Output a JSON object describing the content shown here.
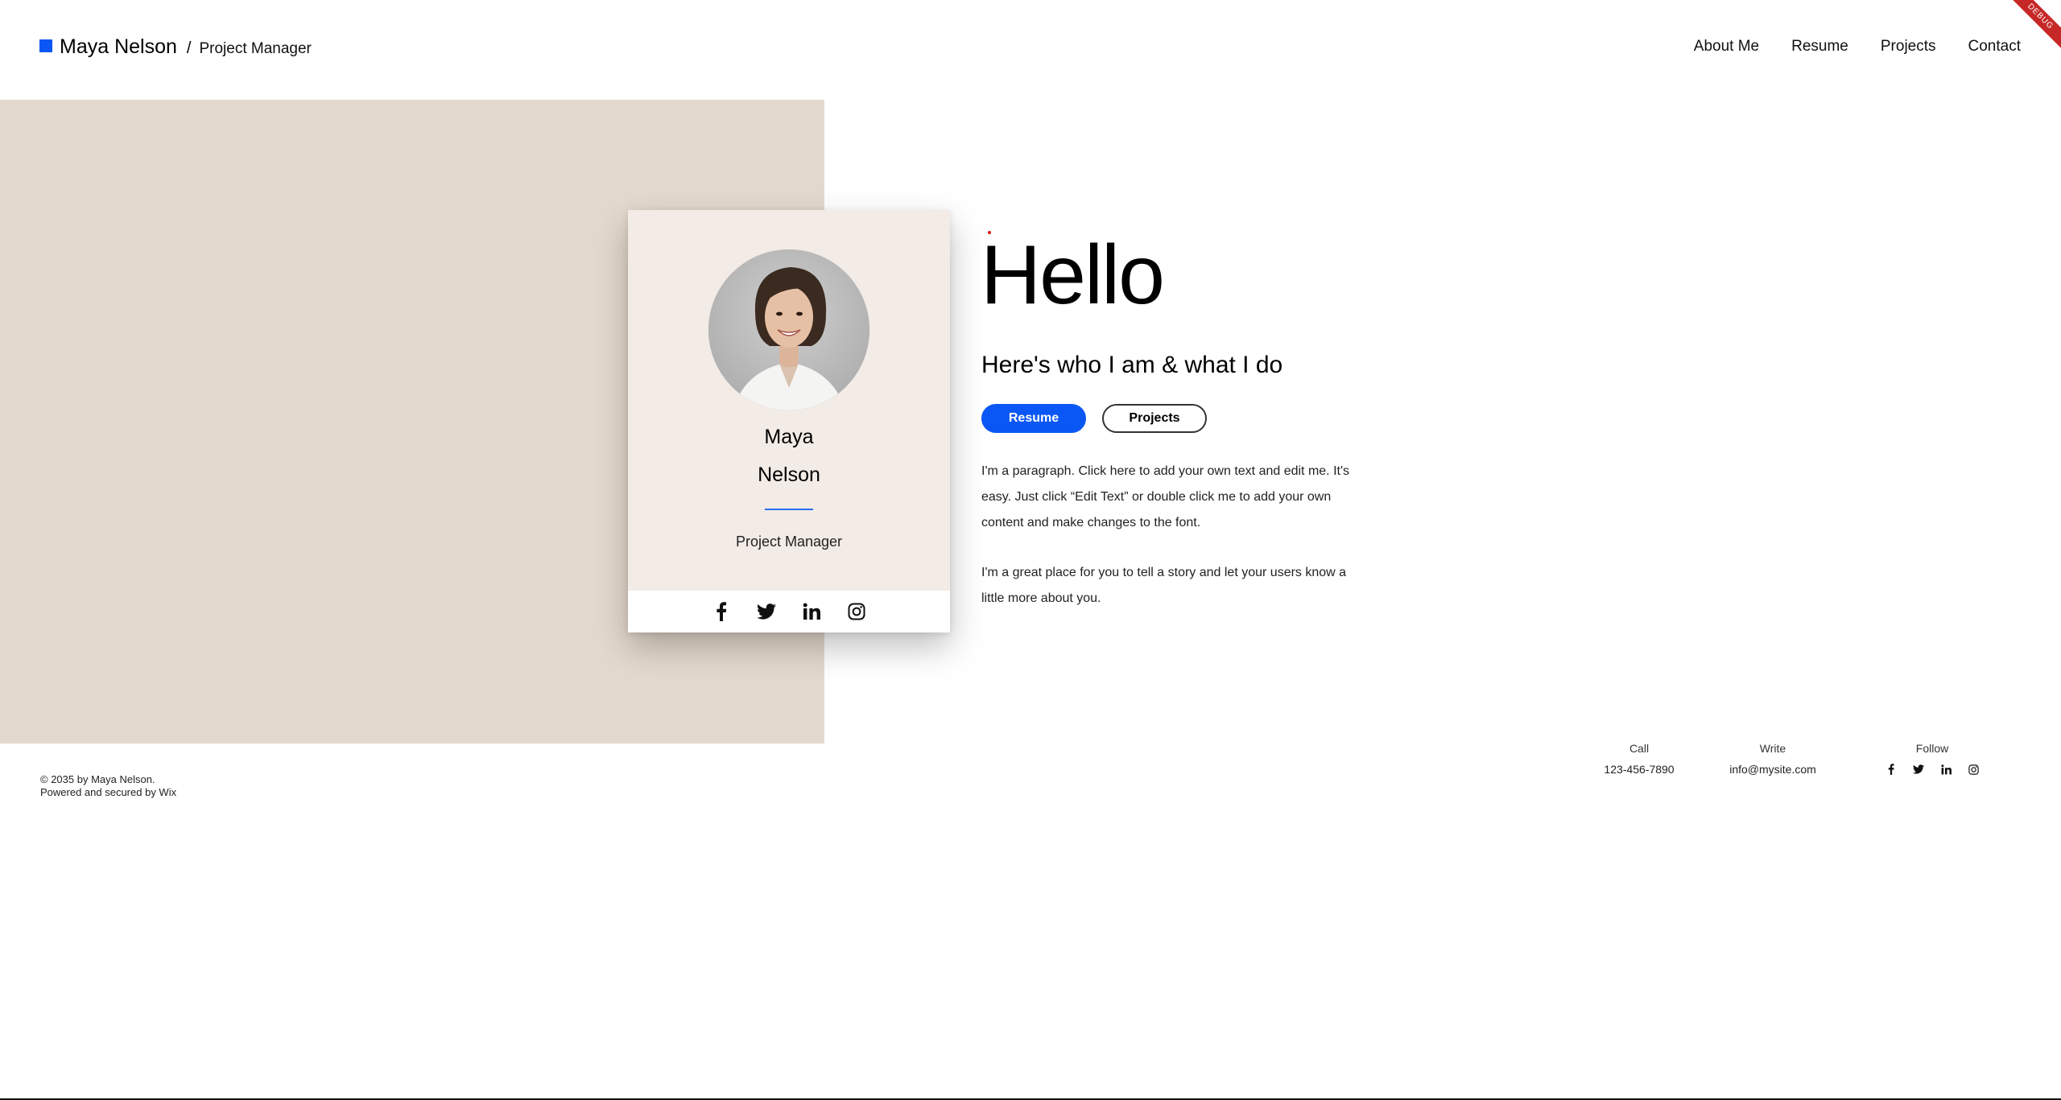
{
  "header": {
    "brand_name": "Maya Nelson",
    "separator": "/",
    "brand_role": "Project Manager",
    "nav": [
      "About Me",
      "Resume",
      "Projects",
      "Contact"
    ],
    "ribbon": "DEBUG"
  },
  "card": {
    "first_name": "Maya",
    "last_name": "Nelson",
    "role": "Project Manager",
    "social": [
      "facebook-icon",
      "twitter-icon",
      "linkedin-icon",
      "instagram-icon"
    ]
  },
  "hero": {
    "title": "Hello",
    "subtitle": "Here's who I am & what I do",
    "resume_button": "Resume",
    "projects_button": "Projects",
    "paragraph_1": "I'm a paragraph. Click here to add your own text and edit me. It's easy. Just click “Edit Text” or double click me to add your own content and make changes to the font.",
    "paragraph_2": "I'm a great place for you to tell a story and let your users know a little more about you."
  },
  "footer": {
    "copyright_line1": "© 2035 by Maya Nelson.",
    "copyright_line2": "Powered and secured by Wix",
    "call_label": "Call",
    "call_value": "123-456-7890",
    "write_label": "Write",
    "write_value": "info@mysite.com",
    "follow_label": "Follow"
  },
  "colors": {
    "accent": "#0b57f5",
    "beige": "#e4d9cd",
    "card_bg": "#f2ebe6"
  }
}
